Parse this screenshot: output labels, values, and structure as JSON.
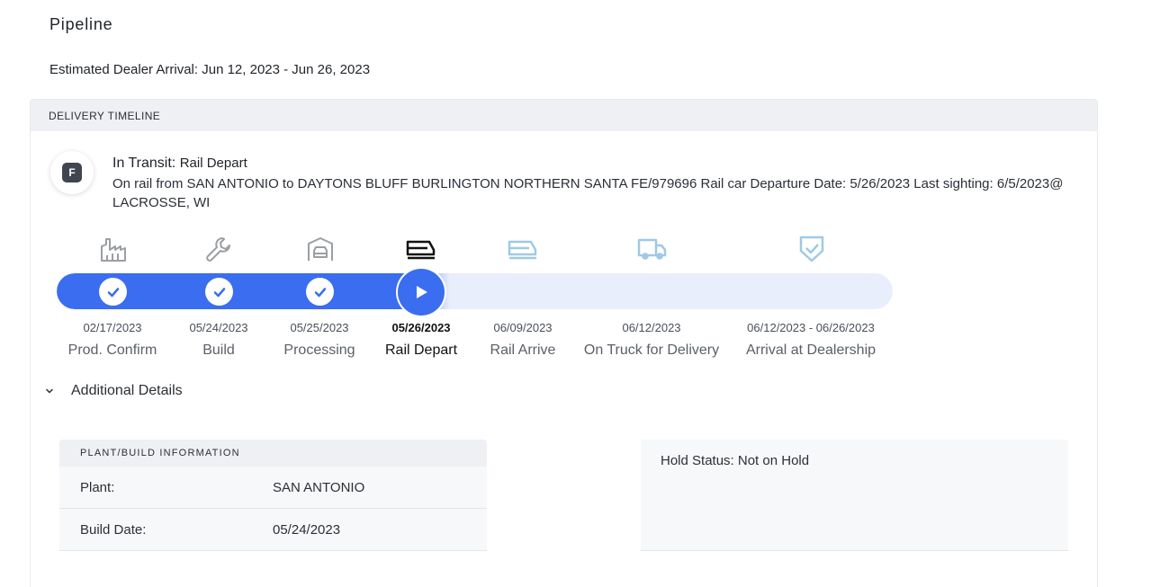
{
  "page_title": "Pipeline",
  "eta": "Estimated Dealer Arrival: Jun 12, 2023 - Jun 26, 2023",
  "timeline": {
    "header": "DELIVERY TIMELINE",
    "avatar_letter": "F",
    "status_prefix": "In Transit:",
    "status_stage": "Rail Depart",
    "status_description": "On rail from SAN ANTONIO to DAYTONS BLUFF BURLINGTON NORTHERN SANTA FE/979696 Rail car Departure Date: 5/26/2023 Last sighting: 6/5/2023@ LACROSSE, WI",
    "progress_fraction": 0.47,
    "colors": {
      "accent": "#3a6df0",
      "completed_icon": "#9b9ea3",
      "current_icon": "#111111",
      "upcoming_icon": "#9fc9e6"
    },
    "stages": [
      {
        "label": "Prod. Confirm",
        "date": "02/17/2023",
        "state": "complete",
        "icon": "factory-icon"
      },
      {
        "label": "Build",
        "date": "05/24/2023",
        "state": "complete",
        "icon": "wrench-icon"
      },
      {
        "label": "Processing",
        "date": "05/25/2023",
        "state": "complete",
        "icon": "vehicle-processing-icon"
      },
      {
        "label": "Rail Depart",
        "date": "05/26/2023",
        "state": "current",
        "icon": "rail-car-icon"
      },
      {
        "label": "Rail Arrive",
        "date": "06/09/2023",
        "state": "upcoming",
        "icon": "rail-car-icon"
      },
      {
        "label": "On Truck for Delivery",
        "date": "06/12/2023",
        "state": "upcoming",
        "icon": "truck-icon"
      },
      {
        "label": "Arrival at Dealership",
        "date": "06/12/2023 - 06/26/2023",
        "state": "upcoming",
        "icon": "shield-check-icon"
      }
    ]
  },
  "details": {
    "toggle_label": "Additional Details",
    "plant": {
      "header": "PLANT/BUILD INFORMATION",
      "rows": [
        {
          "key": "Plant:",
          "value": "SAN ANTONIO"
        },
        {
          "key": "Build Date:",
          "value": "05/24/2023"
        }
      ]
    },
    "hold_status": "Hold Status: Not on Hold"
  }
}
